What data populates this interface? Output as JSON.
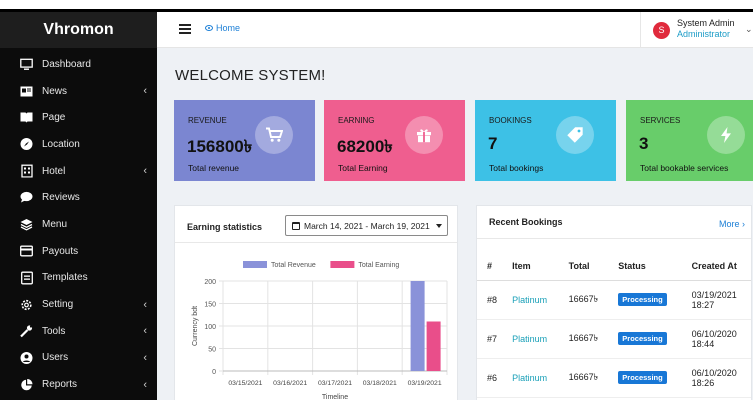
{
  "app": {
    "title": "Vhromon"
  },
  "sidebar": {
    "items": [
      {
        "label": "Dashboard",
        "icon": "monitor-icon",
        "has_submenu": false
      },
      {
        "label": "News",
        "icon": "newspaper-icon",
        "has_submenu": true
      },
      {
        "label": "Page",
        "icon": "book-icon",
        "has_submenu": false
      },
      {
        "label": "Location",
        "icon": "compass-icon",
        "has_submenu": false
      },
      {
        "label": "Hotel",
        "icon": "building-icon",
        "has_submenu": true
      },
      {
        "label": "Reviews",
        "icon": "comment-icon",
        "has_submenu": false
      },
      {
        "label": "Menu",
        "icon": "layers-icon",
        "has_submenu": false
      },
      {
        "label": "Payouts",
        "icon": "credit-card-icon",
        "has_submenu": false
      },
      {
        "label": "Templates",
        "icon": "template-icon",
        "has_submenu": false
      },
      {
        "label": "Setting",
        "icon": "gear-icon",
        "has_submenu": true
      },
      {
        "label": "Tools",
        "icon": "wrench-icon",
        "has_submenu": true
      },
      {
        "label": "Users",
        "icon": "user-icon",
        "has_submenu": true
      },
      {
        "label": "Reports",
        "icon": "pie-chart-icon",
        "has_submenu": true
      }
    ]
  },
  "header": {
    "breadcrumb": "Home",
    "user": {
      "initial": "S",
      "name": "System Admin",
      "role": "Administrator"
    }
  },
  "main": {
    "title": "WELCOME SYSTEM!",
    "stats": [
      {
        "title": "REVENUE",
        "value": "156800৳",
        "desc": "Total revenue",
        "color": "#7b86d1",
        "icon": "cart-icon"
      },
      {
        "title": "EARNING",
        "value": "68200৳",
        "desc": "Total Earning",
        "color": "#ef5e8f",
        "icon": "gift-icon"
      },
      {
        "title": "BOOKINGS",
        "value": "7",
        "desc": "Total bookings",
        "color": "#3dc1e6",
        "icon": "tag-icon"
      },
      {
        "title": "SERVICES",
        "value": "3",
        "desc": "Total bookable services",
        "color": "#68cd6a",
        "icon": "bolt-icon"
      }
    ],
    "earning_card": {
      "title": "Earning statistics",
      "date_range": "March 14, 2021 - March 19, 2021"
    },
    "recent_card": {
      "title": "Recent Bookings",
      "more_label": "More",
      "columns": [
        "#",
        "Item",
        "Total",
        "Status",
        "Created At"
      ],
      "rows": [
        {
          "id": "#8",
          "item": "Platinum",
          "total": "16667৳",
          "status": "Processing",
          "created_date": "03/19/2021",
          "created_time": "18:27"
        },
        {
          "id": "#7",
          "item": "Platinum",
          "total": "16667৳",
          "status": "Processing",
          "created_date": "06/10/2020",
          "created_time": "18:44"
        },
        {
          "id": "#6",
          "item": "Platinum",
          "total": "16667৳",
          "status": "Processing",
          "created_date": "06/10/2020",
          "created_time": "18:26"
        }
      ]
    }
  },
  "chart_data": {
    "type": "bar",
    "categories": [
      "03/15/2021",
      "03/16/2021",
      "03/17/2021",
      "03/18/2021",
      "03/19/2021"
    ],
    "series": [
      {
        "name": "Total Revenue",
        "values": [
          0,
          0,
          0,
          0,
          200
        ],
        "color": "#8a92d9"
      },
      {
        "name": "Total Earning",
        "values": [
          0,
          0,
          0,
          0,
          110
        ],
        "color": "#e94e8a"
      }
    ],
    "xlabel": "Timeline",
    "ylabel": "Currency bdt",
    "ylim": [
      0,
      200
    ],
    "yticks": [
      0,
      50,
      100,
      150,
      200
    ],
    "grid": true,
    "legend": "top"
  }
}
